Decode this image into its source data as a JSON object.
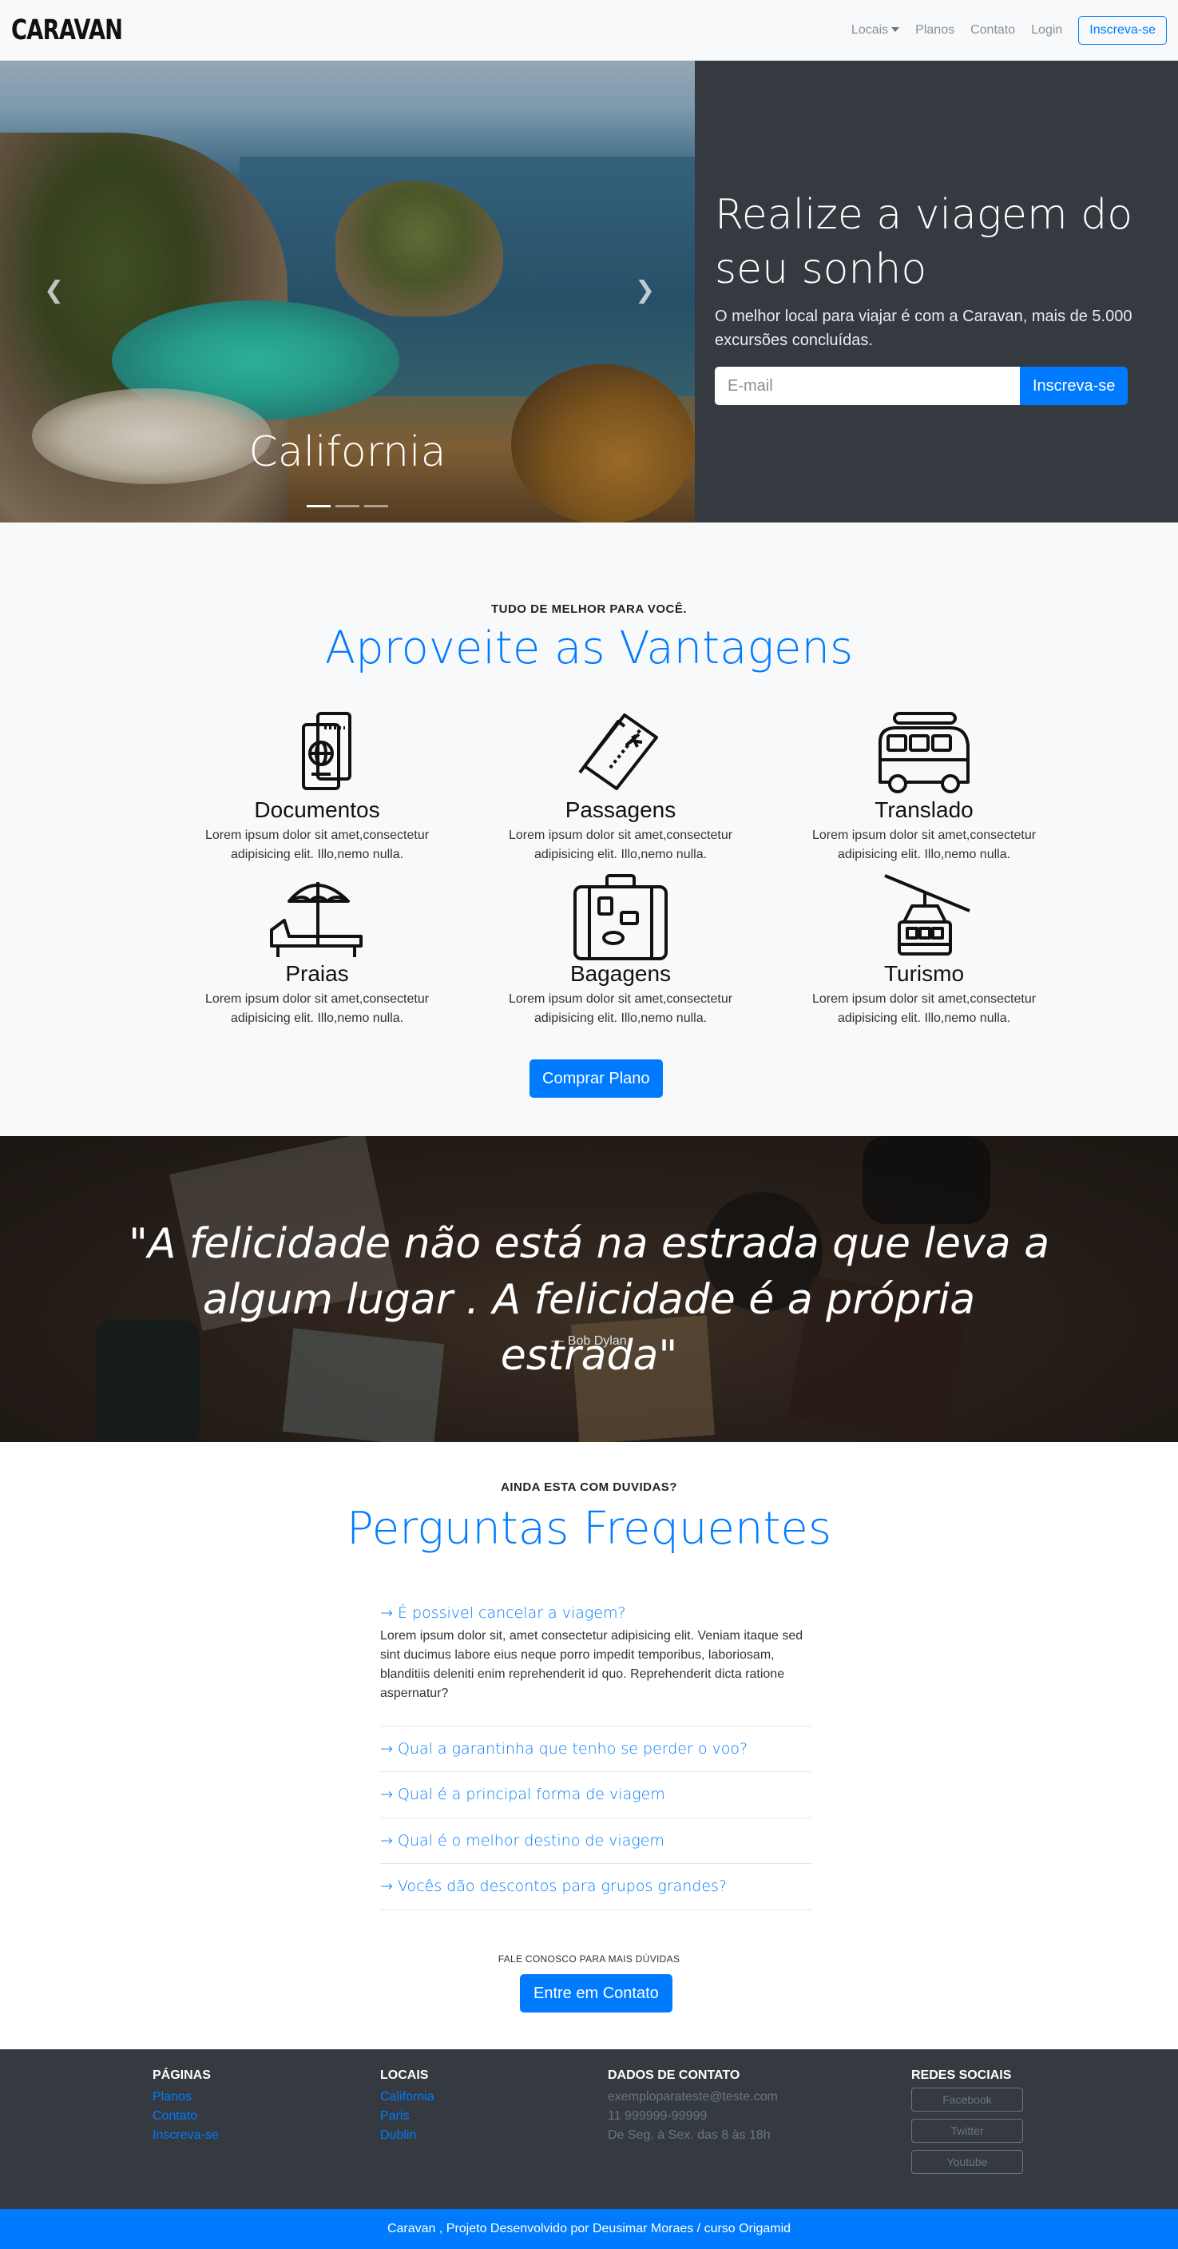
{
  "navbar": {
    "logo": "CARAVAN",
    "links": [
      "Locais",
      "Planos",
      "Contato",
      "Login"
    ],
    "signup": "Inscreva-se"
  },
  "hero": {
    "caption": "California",
    "title": "Realize a viagem do seu sonho",
    "subtitle": "O melhor local para viajar é com a Caravan, mais de 5.000 excursões concluídas.",
    "email_placeholder": "E-mail",
    "button": "Inscreva-se"
  },
  "vantagens": {
    "eyebrow": "TUDO DE MELHOR PARA VOCÊ.",
    "title": "Aproveite as Vantagens",
    "items": [
      {
        "title": "Documentos",
        "text": "Lorem ipsum dolor sit amet,consectetur adipisicing elit. Illo,nemo nulla.",
        "icon": "passport-icon"
      },
      {
        "title": "Passagens",
        "text": "Lorem ipsum dolor sit amet,consectetur adipisicing elit. Illo,nemo nulla.",
        "icon": "ticket-icon"
      },
      {
        "title": "Translado",
        "text": "Lorem ipsum dolor sit amet,consectetur adipisicing elit. Illo,nemo nulla.",
        "icon": "van-icon"
      },
      {
        "title": "Praias",
        "text": "Lorem ipsum dolor sit amet,consectetur adipisicing elit. Illo,nemo nulla.",
        "icon": "beach-umbrella-icon"
      },
      {
        "title": "Bagagens",
        "text": "Lorem ipsum dolor sit amet,consectetur adipisicing elit. Illo,nemo nulla.",
        "icon": "suitcase-icon"
      },
      {
        "title": "Turismo",
        "text": "Lorem ipsum dolor sit amet,consectetur adipisicing elit. Illo,nemo nulla.",
        "icon": "cable-car-icon"
      }
    ],
    "button": "Comprar Plano"
  },
  "quote": {
    "text": "\"A felicidade não está na estrada que leva a algum lugar . A felicidade é a própria estrada\"",
    "author": "— Bob Dylan"
  },
  "faq": {
    "eyebrow": "AINDA ESTA COM DUVIDAS?",
    "title": "Perguntas Frequentes",
    "items": [
      {
        "q": "→ É possivel cancelar a viagem?",
        "a": "Lorem ipsum dolor sit, amet consectetur adipisicing elit. Veniam itaque sed sint ducimus labore eius neque porro impedit temporibus, laboriosam, blanditiis deleniti enim reprehenderit id quo. Reprehenderit dicta ratione aspernatur?"
      },
      {
        "q": "→ Qual a garantinha que tenho se perder o voo?"
      },
      {
        "q": "→ Qual é a principal forma de viagem"
      },
      {
        "q": "→ Qual é o melhor destino de viagem"
      },
      {
        "q": "→ Vocês dão descontos para grupos grandes?"
      }
    ],
    "contact_label": "FALE CONOSCO PARA MAIS DÚVIDAS",
    "contact_button": "Entre em Contato"
  },
  "footer": {
    "paginas": {
      "title": "PÁGINAS",
      "links": [
        "Planos",
        "Contato",
        "Inscreva-se"
      ]
    },
    "locais": {
      "title": "LOCAIS",
      "links": [
        "California",
        "Paris",
        "Dublin"
      ]
    },
    "contato": {
      "title": "DADOS DE CONTATO",
      "lines": [
        "exemploparateste@teste.com",
        "11 999999-99999",
        "De Seg. à Sex. das 8 às 18h"
      ]
    },
    "redes": {
      "title": "REDES SOCIAIS",
      "buttons": [
        "Facebook",
        "Twitter",
        "Youtube"
      ]
    },
    "bottom": "Caravan , Projeto Desenvolvido por Deusimar Moraes / curso Origamid"
  },
  "colors": {
    "primary": "#007bff",
    "dark": "#343a40",
    "light": "#f8f9fa"
  }
}
